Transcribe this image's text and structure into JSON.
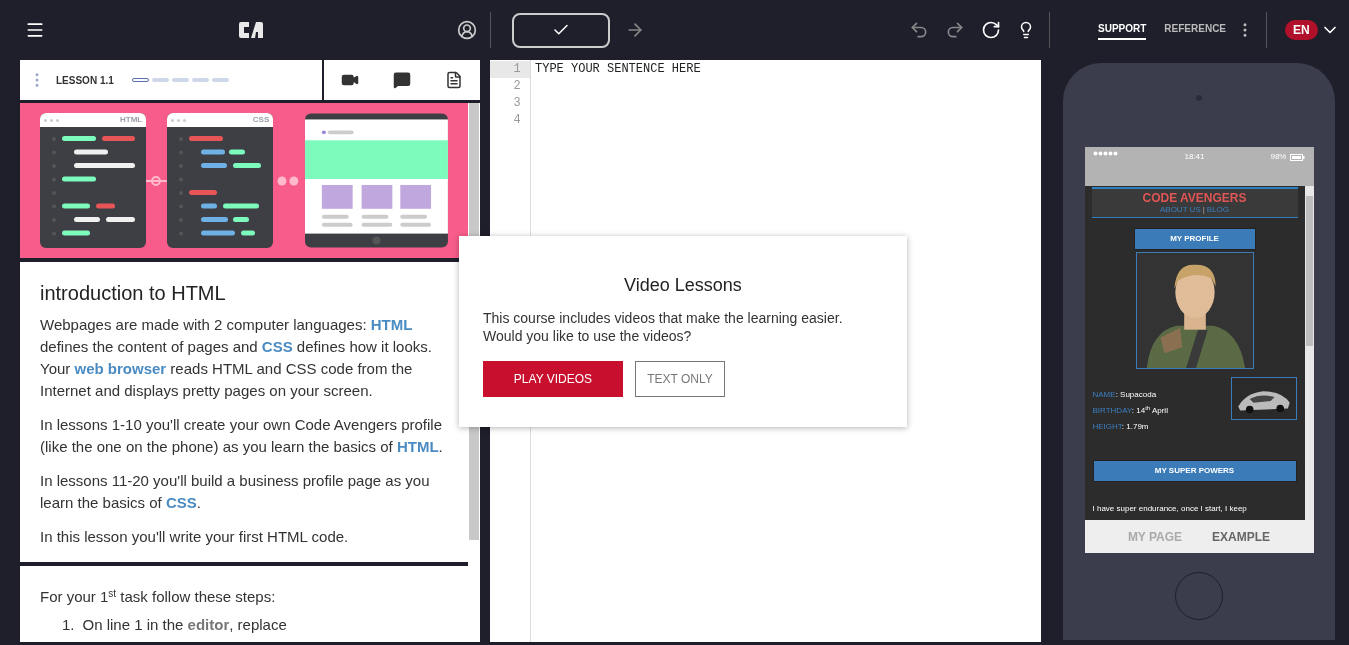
{
  "topbar": {
    "nav": [
      {
        "label": "SUPPORT",
        "selected": true
      },
      {
        "label": "REFERENCE",
        "selected": false
      }
    ],
    "language": "EN"
  },
  "lesson": {
    "label": "LESSON 1.1",
    "progress": [
      {
        "selected": true
      },
      {
        "selected": false
      },
      {
        "selected": false
      },
      {
        "selected": false
      },
      {
        "selected": false
      }
    ],
    "illustration": {
      "labels": [
        "HTML",
        "CSS"
      ]
    },
    "title": "introduction to HTML",
    "paragraphs": [
      "Webpages are made with 2 computer languages: **HTML** defines the content of pages and **CSS** defines how it looks. Your **web browser** reads HTML and CSS code from the Internet and displays pretty pages on your screen.",
      "In lessons 1-10 you'll create your own Code Avengers profile (like the one on the phone) as you learn the basics of **HTML**.",
      "In lessons 11-20 you'll build a business profile page as you learn the basics of **CSS**.",
      "In this lesson you'll write your first HTML code."
    ],
    "task": {
      "intro": "For your 1$^{st}$ task follow these steps:",
      "steps": [
        {
          "number": "1.",
          "text": "On line 1 in the **editor**, replace"
        }
      ]
    }
  },
  "editor": {
    "lines": [
      {
        "number": "1",
        "text": "TYPE YOUR SENTENCE HERE",
        "active": true
      },
      {
        "number": "2",
        "active": false
      },
      {
        "number": "3",
        "active": false
      },
      {
        "number": "4",
        "active": false
      }
    ]
  },
  "modal": {
    "title": "Video Lessons",
    "text": "This course includes videos that make the learning easier. Would you like to use the videos?",
    "buttons": [
      {
        "label": "PLAY VIDEOS",
        "kind": "primary"
      },
      {
        "label": "TEXT ONLY",
        "kind": "secondary"
      }
    ]
  },
  "phone": {
    "status": {
      "time": "18:41",
      "battery": "98%"
    },
    "site": {
      "title": "CODE AVENGERS",
      "nav": [
        "ABOUT US",
        "BLOG"
      ],
      "separator": "|",
      "profile_button": "MY PROFILE",
      "facts": [
        {
          "label": "NAME",
          "value": ": Supacoda"
        },
        {
          "label": "BIRTHDAY",
          "value": ": 14$^{th}$ April"
        },
        {
          "label": "HEIGHT",
          "value": ": 1.79m"
        }
      ],
      "powers_button": "MY SUPER POWERS",
      "bio": "I have super endurance, once I start, I keep"
    },
    "tabs": [
      {
        "label": "MY PAGE",
        "selected": false
      },
      {
        "label": "EXAMPLE",
        "selected": true
      }
    ]
  }
}
